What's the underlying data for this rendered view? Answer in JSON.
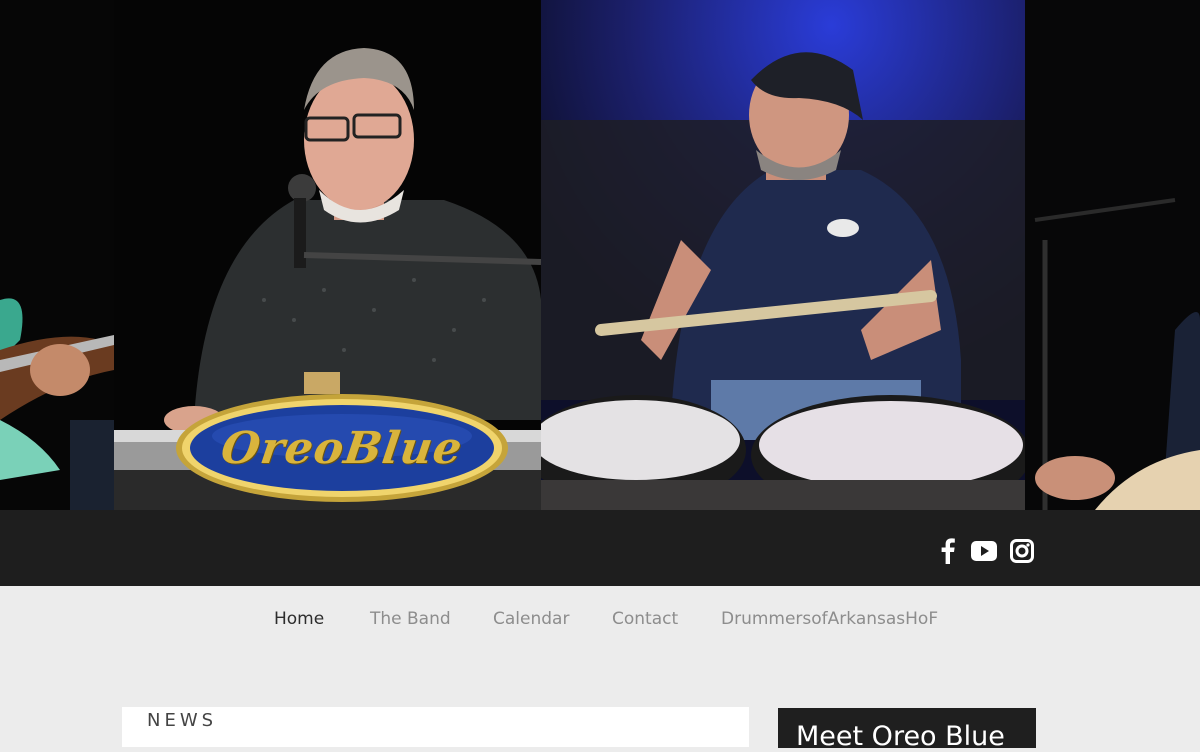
{
  "logo": {
    "text": "OreoBlue"
  },
  "social": {
    "items": [
      "facebook-icon",
      "youtube-icon",
      "instagram-icon"
    ]
  },
  "nav": {
    "home": "Home",
    "band": "The Band",
    "calendar": "Calendar",
    "contact": "Contact",
    "hof": "DrummersofArkansasHoF"
  },
  "news": {
    "heading": "NEWS"
  },
  "meet": {
    "title": "Meet Oreo Blue"
  },
  "colors": {
    "logo_blue": "#1c3f9e",
    "logo_gold": "#d9b43c",
    "social_bar": "#1e1e1e",
    "page_bg": "#ececec"
  }
}
